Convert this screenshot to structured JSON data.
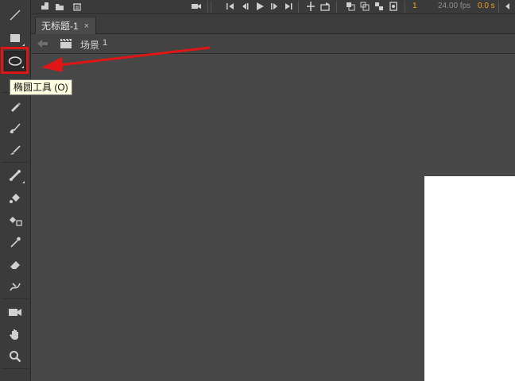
{
  "timeline": {
    "current_frame": "1",
    "fps": "24.00 fps",
    "time": "0.0 s",
    "accent_color": "#f0a21a"
  },
  "document": {
    "tab_title": "无标题-1",
    "close_glyph": "×"
  },
  "scene": {
    "label": "场景",
    "number": "1"
  },
  "toolbar": {
    "tools": [
      {
        "name": "line-tool",
        "icon": "line-icon"
      },
      {
        "name": "rectangle-tool",
        "icon": "rectangle-icon"
      },
      {
        "name": "oval-tool",
        "icon": "oval-icon",
        "active": true
      },
      {
        "name": "pencil-tool",
        "icon": "pencil-icon"
      },
      {
        "name": "paint-brush-tool",
        "icon": "paint-brush-icon"
      },
      {
        "name": "brush-tool",
        "icon": "brush-icon"
      },
      {
        "name": "bone-tool",
        "icon": "bone-icon"
      },
      {
        "name": "paint-bucket-tool",
        "icon": "paint-bucket-icon"
      },
      {
        "name": "ink-bottle-tool",
        "icon": "ink-bottle-icon"
      },
      {
        "name": "eyedropper-tool",
        "icon": "eyedropper-icon"
      },
      {
        "name": "eraser-tool",
        "icon": "eraser-icon"
      },
      {
        "name": "width-tool",
        "icon": "width-icon"
      },
      {
        "name": "camera-tool",
        "icon": "camera-icon"
      },
      {
        "name": "hand-tool",
        "icon": "hand-icon"
      },
      {
        "name": "zoom-tool",
        "icon": "zoom-icon"
      }
    ]
  },
  "tooltip": {
    "text": "椭圆工具 (O)"
  },
  "annotation": {
    "color": "#e01616"
  }
}
